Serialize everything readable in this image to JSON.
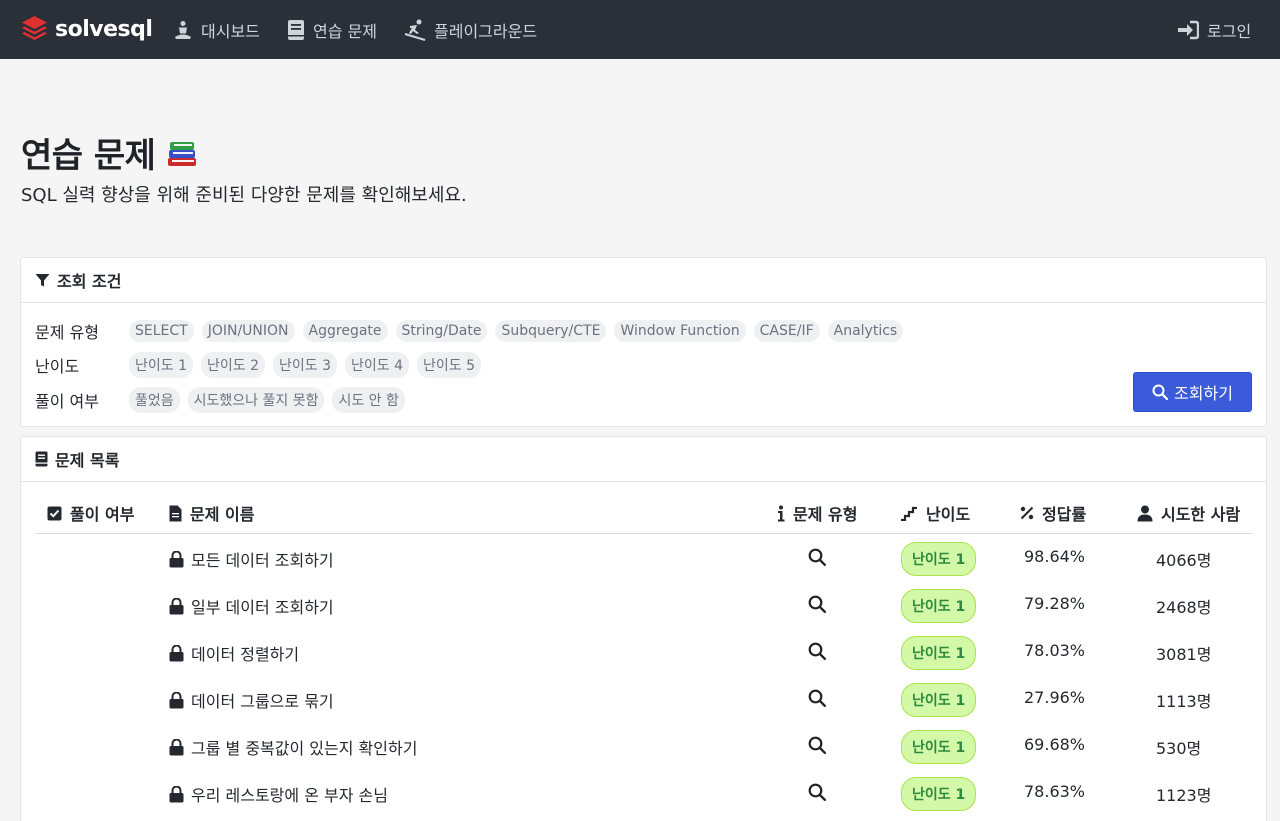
{
  "navbar": {
    "brand": "solvesql",
    "items": [
      {
        "label": "대시보드",
        "icon": "person-meditation-icon"
      },
      {
        "label": "연습 문제",
        "icon": "book-icon"
      },
      {
        "label": "플레이그라운드",
        "icon": "person-skiing-icon"
      }
    ],
    "login": {
      "label": "로그인",
      "icon": "sign-in-icon"
    }
  },
  "header": {
    "title": "연습 문제",
    "subtitle": "SQL 실력 향상을 위해 준비된 다양한 문제를 확인해보세요."
  },
  "filter": {
    "title": "조회 조건",
    "type_label": "문제 유형",
    "types": [
      "SELECT",
      "JOIN/UNION",
      "Aggregate",
      "String/Date",
      "Subquery/CTE",
      "Window Function",
      "CASE/IF",
      "Analytics"
    ],
    "level_label": "난이도",
    "levels": [
      "난이도 1",
      "난이도 2",
      "난이도 3",
      "난이도 4",
      "난이도 5"
    ],
    "solved_label": "풀이 여부",
    "solved_options": [
      "풀었음",
      "시도했으나 풀지 못함",
      "시도 안 함"
    ],
    "search_button": "조회하기"
  },
  "list": {
    "title": "문제 목록",
    "columns": {
      "solved": "풀이 여부",
      "name": "문제 이름",
      "type": "문제 유형",
      "level": "난이도",
      "rate": "정답률",
      "users": "시도한 사람"
    },
    "rows": [
      {
        "name": "모든 데이터 조회하기",
        "level": "난이도 1",
        "rate": "98.64%",
        "users": "4066명"
      },
      {
        "name": "일부 데이터 조회하기",
        "level": "난이도 1",
        "rate": "79.28%",
        "users": "2468명"
      },
      {
        "name": "데이터 정렬하기",
        "level": "난이도 1",
        "rate": "78.03%",
        "users": "3081명"
      },
      {
        "name": "데이터 그룹으로 묶기",
        "level": "난이도 1",
        "rate": "27.96%",
        "users": "1113명"
      },
      {
        "name": "그룹 별 중복값이 있는지 확인하기",
        "level": "난이도 1",
        "rate": "69.68%",
        "users": "530명"
      },
      {
        "name": "우리 레스토랑에 온 부자 손님",
        "level": "난이도 1",
        "rate": "78.63%",
        "users": "1123명"
      }
    ]
  },
  "colors": {
    "navbar": "#2b2f38",
    "primary": "#3b5bdb",
    "badge_bg": "#d3f9a8",
    "badge_text": "#2b8a3e"
  }
}
